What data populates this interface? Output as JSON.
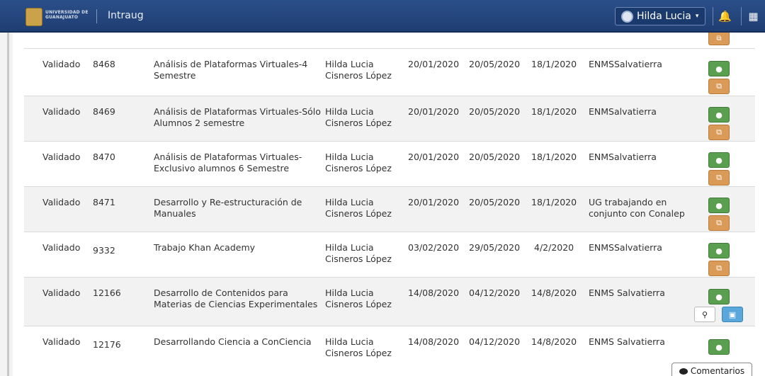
{
  "navbar": {
    "logo_text_line1": "UNIVERSIDAD DE",
    "logo_text_line2": "GUANAJUATO",
    "app_name": "Intraug",
    "user_name": "Hilda Lucia",
    "user_caret": "▾",
    "bell_icon": "🔔",
    "grid_icon": "▦"
  },
  "icons": {
    "view": "●",
    "copy": "⧉",
    "search": "⚲",
    "pdf": "▣"
  },
  "rows": [
    {
      "status": "Validado",
      "id": "8468",
      "name": "Análisis de Plataformas Virtuales-4 Semestre",
      "owner": "Hilda Lucia Cisneros López",
      "start": "20/01/2020",
      "end": "20/05/2020",
      "registered": "18/1/2020",
      "place": "ENMSSalvatierra"
    },
    {
      "status": "Validado",
      "id": "8469",
      "name": "Análisis de Plataformas Virtuales-Sólo Alumnos 2 semestre",
      "owner": "Hilda Lucia Cisneros López",
      "start": "20/01/2020",
      "end": "20/05/2020",
      "registered": "18/1/2020",
      "place": "ENMSalvatierra"
    },
    {
      "status": "Validado",
      "id": "8470",
      "name": "Análisis de Plataformas Virtuales-Exclusivo alumnos 6 Semestre",
      "owner": "Hilda Lucia Cisneros López",
      "start": "20/01/2020",
      "end": "20/05/2020",
      "registered": "18/1/2020",
      "place": "ENMSalvatierra"
    },
    {
      "status": "Validado",
      "id": "8471",
      "name": "Desarrollo y Re-estructuración de Manuales",
      "owner": "Hilda Lucia Cisneros López",
      "start": "20/01/2020",
      "end": "20/05/2020",
      "registered": "18/1/2020",
      "place": "UG trabajando en conjunto con Conalep"
    },
    {
      "status": "Validado",
      "id": "9332",
      "name": "Trabajo Khan Academy",
      "owner": "Hilda Lucia Cisneros López",
      "start": "03/02/2020",
      "end": "29/05/2020",
      "registered": "4/2/2020",
      "place": "ENMSSalvatierra"
    },
    {
      "status": "Validado",
      "id": "12166",
      "name": "Desarrollo de Contenidos para Materias de Ciencias Experimentales",
      "owner": "Hilda Lucia Cisneros López",
      "start": "14/08/2020",
      "end": "04/12/2020",
      "registered": "14/8/2020",
      "place": "ENMS Salvatierra"
    },
    {
      "status": "Validado",
      "id": "12176",
      "name": "Desarrollando Ciencia a ConCiencia",
      "owner": "Hilda Lucia Cisneros López",
      "start": "14/08/2020",
      "end": "04/12/2020",
      "registered": "14/8/2020",
      "place": "ENMS Salvatierra"
    }
  ],
  "comments_button": "Comentarios"
}
